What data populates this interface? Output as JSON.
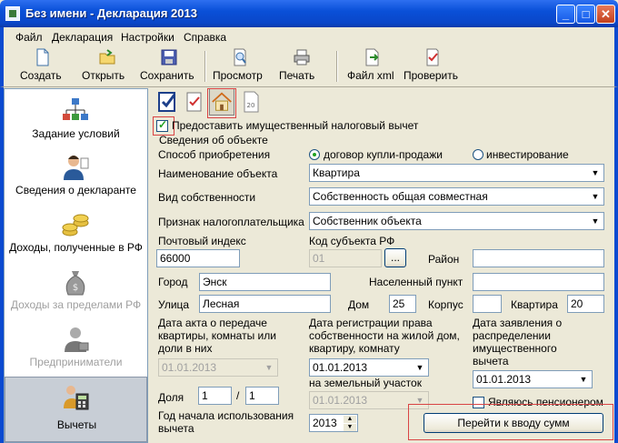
{
  "window": {
    "title": "Без имени - Декларация 2013"
  },
  "menu": [
    "Файл",
    "Декларация",
    "Настройки",
    "Справка"
  ],
  "toolbar": {
    "create": "Создать",
    "open": "Открыть",
    "save": "Сохранить",
    "preview": "Просмотр",
    "print": "Печать",
    "xml": "Файл xml",
    "check": "Проверить"
  },
  "sidebar": {
    "items": [
      {
        "label": "Задание условий",
        "icon": "tree-diagram-icon",
        "enabled": true
      },
      {
        "label": "Сведения о декларанте",
        "icon": "person-icon",
        "enabled": true
      },
      {
        "label": "Доходы, полученные в РФ",
        "icon": "coins-icon",
        "enabled": true
      },
      {
        "label": "Доходы за пределами РФ",
        "icon": "money-bag-icon",
        "enabled": false
      },
      {
        "label": "Предприниматели",
        "icon": "businessman-icon",
        "enabled": false
      },
      {
        "label": "Вычеты",
        "icon": "calculator-person-icon",
        "enabled": true,
        "active": true
      }
    ]
  },
  "form": {
    "provide_deduction": "Предоставить имущественный налоговый вычет",
    "object_group": "Сведения об объекте",
    "acquisition_method_label": "Способ приобретения",
    "acquisition_option_1": "договор купли-продажи",
    "acquisition_option_2": "инвестирование",
    "object_name_label": "Наименование объекта",
    "object_name_value": "Квартира",
    "ownership_type_label": "Вид собственности",
    "ownership_type_value": "Собственность общая совместная",
    "taxpayer_sign_label": "Признак налогоплательщика",
    "taxpayer_sign_value": "Собственник объекта",
    "postal_code_label": "Почтовый индекс",
    "postal_code_value": "66000",
    "region_code_label": "Код субъекта РФ",
    "region_code_value": "01",
    "region_btn": "...",
    "district_label": "Район",
    "district_value": "",
    "city_label": "Город",
    "city_value": "Энск",
    "settlement_label": "Населенный пункт",
    "settlement_value": "",
    "street_label": "Улица",
    "street_value": "Лесная",
    "house_label": "Дом",
    "house_value": "25",
    "building_label": "Корпус",
    "building_value": "",
    "apartment_label": "Квартира",
    "apartment_value": "20",
    "transfer_act_date_label_1": "Дата акта о передаче",
    "transfer_act_date_label_2": "квартиры, комнаты или",
    "transfer_act_date_label_3": "доли в них",
    "transfer_act_date_value": "01.01.2013",
    "ownership_reg_date_label_1": "Дата регистрации права",
    "ownership_reg_date_label_2": "собственности на жилой дом,",
    "ownership_reg_date_label_3": "квартиру, комнату",
    "ownership_reg_date_value": "01.01.2013",
    "land_plot_label": "на земельный участок",
    "land_plot_value": "01.01.2013",
    "deduction_app_date_label_1": "Дата заявления о",
    "deduction_app_date_label_2": "распределении",
    "deduction_app_date_label_3": "имущественного",
    "deduction_app_date_label_4": "вычета",
    "deduction_app_date_value": "01.01.2013",
    "share_label": "Доля",
    "share_num": "1",
    "share_sep": "/",
    "share_den": "1",
    "year_start_label_1": "Год начала использования",
    "year_start_label_2": "вычета",
    "year_start_value": "2013",
    "pensioner_label": "Являюсь пенсионером",
    "go_to_amounts_button": "Перейти к вводу сумм"
  },
  "colors": {
    "highlight_box": "#d94444",
    "title_blue": "#0a50d8"
  }
}
